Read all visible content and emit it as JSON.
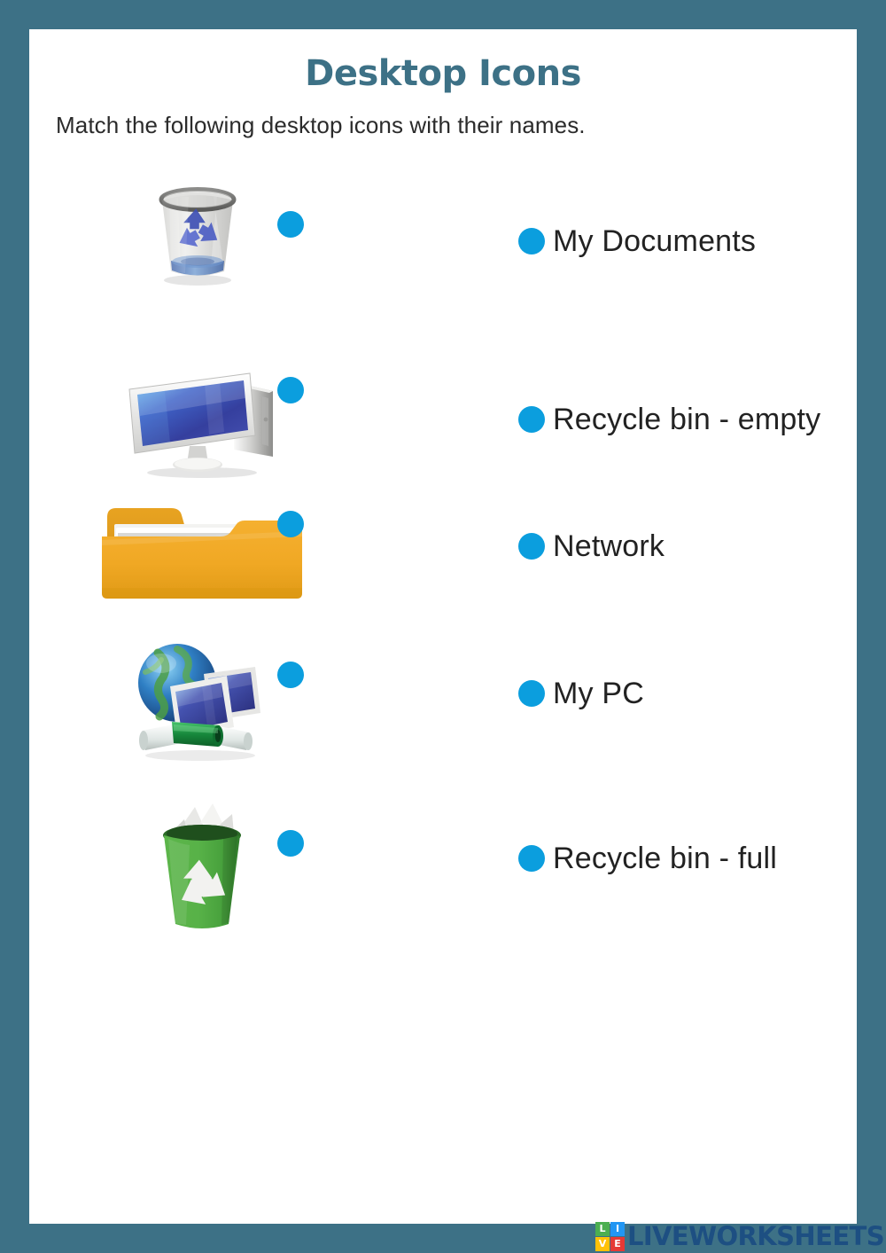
{
  "page": {
    "title": "Desktop Icons",
    "instruction": "Match the following desktop icons with their names.",
    "frame_color": "#3d7186",
    "title_color": "#3d7186",
    "dot_color": "#0b9ede"
  },
  "left_column": [
    {
      "icon": "recycle-bin-empty-icon",
      "label": "recycle bin empty (translucent)"
    },
    {
      "icon": "computer-monitor-icon",
      "label": "computer with monitor and tower"
    },
    {
      "icon": "folder-icon",
      "label": "yellow folder with documents"
    },
    {
      "icon": "network-globe-icon",
      "label": "globe with two monitors and cable"
    },
    {
      "icon": "recycle-bin-full-icon",
      "label": "green recycle bin full of paper"
    }
  ],
  "right_column": [
    {
      "label": "My Documents"
    },
    {
      "label": "Recycle bin - empty"
    },
    {
      "label": "Network"
    },
    {
      "label": "My PC"
    },
    {
      "label": "Recycle bin - full"
    }
  ],
  "footer": {
    "brand": "LIVEWORKSHEETS",
    "tiles": [
      {
        "letter": "L",
        "color": "#4caf50"
      },
      {
        "letter": "I",
        "color": "#2196f3"
      },
      {
        "letter": "V",
        "color": "#ffc107"
      },
      {
        "letter": "E",
        "color": "#e53935"
      }
    ]
  }
}
